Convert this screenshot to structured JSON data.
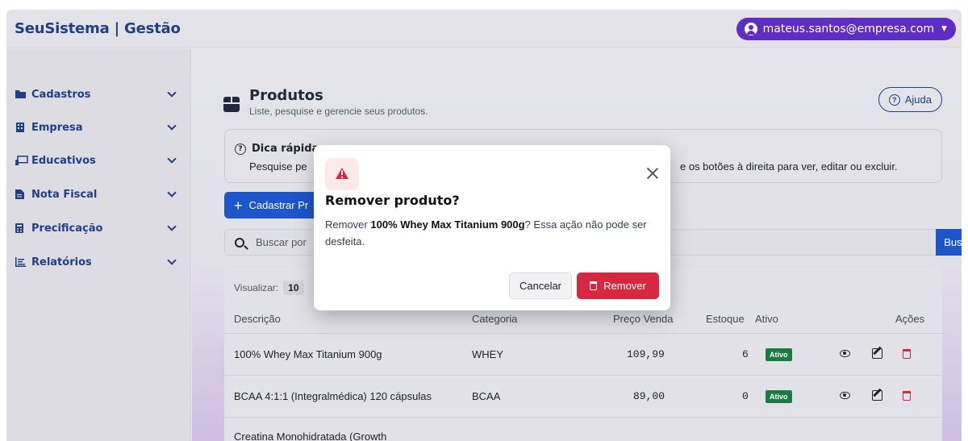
{
  "header": {
    "brand": "SeuSistema | Gestão",
    "user_email": "mateus.santos@empresa.com"
  },
  "sidebar": {
    "items": [
      {
        "label": "Cadastros",
        "icon": "folder-open-icon"
      },
      {
        "label": "Empresa",
        "icon": "building-icon"
      },
      {
        "label": "Educativos",
        "icon": "chalkboard-icon"
      },
      {
        "label": "Nota Fiscal",
        "icon": "file-invoice-icon"
      },
      {
        "label": "Precificação",
        "icon": "calculator-icon"
      },
      {
        "label": "Relatórios",
        "icon": "report-icon"
      }
    ]
  },
  "page": {
    "title": "Produtos",
    "subtitle": "Liste, pesquise e gerencie seus produtos.",
    "help_label": "Ajuda"
  },
  "tip": {
    "title": "Dica rápida",
    "text_start": "Pesquise pe",
    "text_end": "e os botões à direita para ver, editar ou excluir."
  },
  "actions": {
    "add_label": "Cadastrar Pr"
  },
  "search": {
    "placeholder": "Buscar por",
    "button_label": "Buscar"
  },
  "table": {
    "view_label": "Visualizar:",
    "view_value": "10",
    "columns": {
      "descricao": "Descrição",
      "categoria": "Categoria",
      "preco": "Preço Venda",
      "estoque": "Estoque",
      "ativo": "Ativo",
      "acoes": "Ações"
    },
    "rows": [
      {
        "descricao": "100% Whey Max Titanium 900g",
        "categoria": "WHEY",
        "preco": "109,99",
        "estoque": "6",
        "ativo": "Ativo"
      },
      {
        "descricao": "BCAA 4:1:1 (Integralmédica) 120 cápsulas",
        "categoria": "BCAA",
        "preco": "89,00",
        "estoque": "0",
        "ativo": "Ativo"
      },
      {
        "descricao": "Creatina Monohidratada (Growth",
        "categoria": "",
        "preco": "",
        "estoque": "",
        "ativo": ""
      }
    ]
  },
  "modal": {
    "title": "Remover produto?",
    "body_prefix": "Remover ",
    "product_name": "100% Whey Max Titanium 900g",
    "body_suffix": "? Essa ação não pode ser desfeita.",
    "cancel_label": "Cancelar",
    "remove_label": "Remover"
  },
  "colors": {
    "brand": "#1f3f87",
    "user_pill": "#5f2cc4",
    "primary": "#1d56c9",
    "danger": "#d6283f",
    "success_badge": "#1c7a44"
  }
}
